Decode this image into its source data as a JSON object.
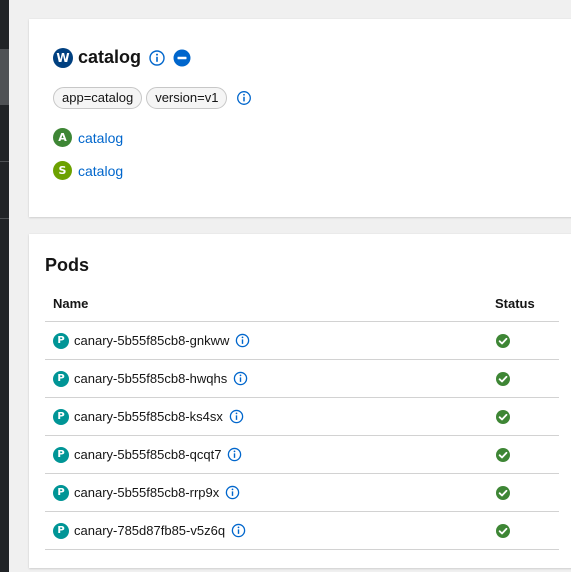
{
  "workload": {
    "badge": "W",
    "name": "catalog",
    "labels": [
      "app=catalog",
      "version=v1"
    ]
  },
  "related": [
    {
      "badge": "A",
      "name": "catalog"
    },
    {
      "badge": "S",
      "name": "catalog"
    }
  ],
  "pods": {
    "title": "Pods",
    "columns": {
      "name": "Name",
      "status": "Status"
    },
    "badge": "P",
    "rows": [
      {
        "name": "canary-5b55f85cb8-gnkww",
        "status": "ok"
      },
      {
        "name": "canary-5b55f85cb8-hwqhs",
        "status": "ok"
      },
      {
        "name": "canary-5b55f85cb8-ks4sx",
        "status": "ok"
      },
      {
        "name": "canary-5b55f85cb8-qcqt7",
        "status": "ok"
      },
      {
        "name": "canary-5b55f85cb8-rrp9x",
        "status": "ok"
      },
      {
        "name": "canary-785d87fb85-v5z6q",
        "status": "ok"
      }
    ]
  },
  "colors": {
    "workload_badge": "#004080",
    "app_badge": "#3e8635",
    "service_badge": "#6ca100",
    "pod_badge": "#009596",
    "link": "#0066cc",
    "status_ok": "#3e8635",
    "info_icon": "#0066cc"
  },
  "icons": {
    "info": "info-circle-icon",
    "minus": "minus-circle-icon",
    "status_ok": "check-circle-icon"
  }
}
